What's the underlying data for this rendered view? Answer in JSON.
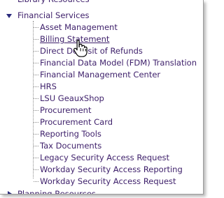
{
  "tree": {
    "prev_item": "Library Resources",
    "open_category": "Financial Services",
    "children": [
      "Asset Management",
      "Billing Statement",
      "Direct Deposit of Refunds",
      "Financial Data Model (FDM) Translation",
      "Financial Management Center",
      "HRS",
      "LSU GeauxShop",
      "Procurement",
      "Procurement Card",
      "Reporting Tools",
      "Tax Documents",
      "Legacy Security Access Request",
      "Workday Security Access Reporting",
      "Workday Security Access Request"
    ],
    "next_item": "Planning Resources",
    "hovered_child": "Billing Statement"
  },
  "colors": {
    "link_text": "#3d1f6a",
    "expander": "#2a2a7c"
  },
  "icons": [
    "expand-triangle-down-icon",
    "collapse-triangle-right-icon",
    "hand-pointer-icon"
  ]
}
